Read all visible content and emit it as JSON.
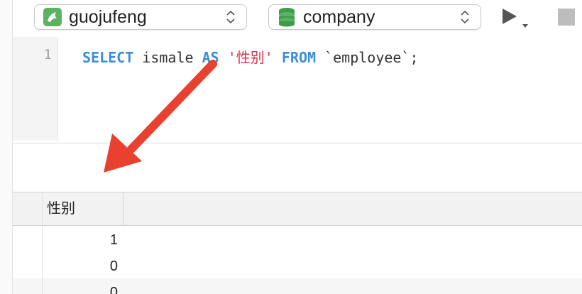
{
  "toolbar": {
    "connection_label": "guojufeng",
    "connection_icon": "mysql-dolphin-icon",
    "database_label": "company",
    "database_icon": "database-stack-icon",
    "run_icon": "play-icon",
    "stop_icon": "stop-icon"
  },
  "editor": {
    "line_numbers": [
      "1"
    ],
    "tokens": {
      "select": "SELECT",
      "column": " ismale ",
      "as": "AS",
      "space1": " ",
      "alias": "'性别'",
      "space2": " ",
      "from": "FROM",
      "table": " `employee`;"
    }
  },
  "results": {
    "columns": [
      "性别"
    ],
    "rows": [
      [
        "1"
      ],
      [
        "0"
      ],
      [
        "0"
      ]
    ]
  },
  "colors": {
    "keyword": "#3b8fd8",
    "string": "#d8324b",
    "arrow": "#e8412f"
  }
}
